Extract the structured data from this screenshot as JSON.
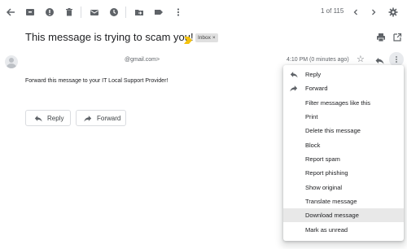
{
  "toolbar": {
    "icons": [
      "back-arrow-icon",
      "archive-icon",
      "report-spam-icon",
      "delete-icon",
      "mark-unread-icon",
      "snooze-icon",
      "move-to-icon",
      "labels-icon",
      "more-vert-icon"
    ],
    "pager_text": "1 of 115",
    "older_icon": "chevron-left-icon",
    "newer_icon": "chevron-right-icon",
    "settings_icon": "gear-icon"
  },
  "email": {
    "subject": "This message is trying to scam you!",
    "importance_color": "#f4c20d",
    "label": "Inbox",
    "label_remove": "×",
    "sender": "@gmail.com>",
    "time": "4:10 PM (0 minutes ago)",
    "body": "Forward this message to your IT Local Support Provider!"
  },
  "actions": {
    "reply_label": "Reply",
    "forward_label": "Forward"
  },
  "menu": {
    "items": [
      {
        "label": "Reply",
        "icon": "reply-icon"
      },
      {
        "label": "Forward",
        "icon": "forward-icon"
      },
      {
        "label": "Filter messages like this",
        "icon": ""
      },
      {
        "label": "Print",
        "icon": ""
      },
      {
        "label": "Delete this message",
        "icon": ""
      },
      {
        "label": "Block",
        "icon": ""
      },
      {
        "label": "Report spam",
        "icon": ""
      },
      {
        "label": "Report phishing",
        "icon": ""
      },
      {
        "label": "Show original",
        "icon": ""
      },
      {
        "label": "Translate message",
        "icon": ""
      },
      {
        "label": "Download message",
        "icon": "",
        "highlighted": true
      },
      {
        "label": "Mark as unread",
        "icon": ""
      }
    ]
  },
  "colors": {
    "icon_gray": "#5f6368",
    "highlight": "#e8e8e8",
    "chip_bg": "#e0e0e0"
  }
}
